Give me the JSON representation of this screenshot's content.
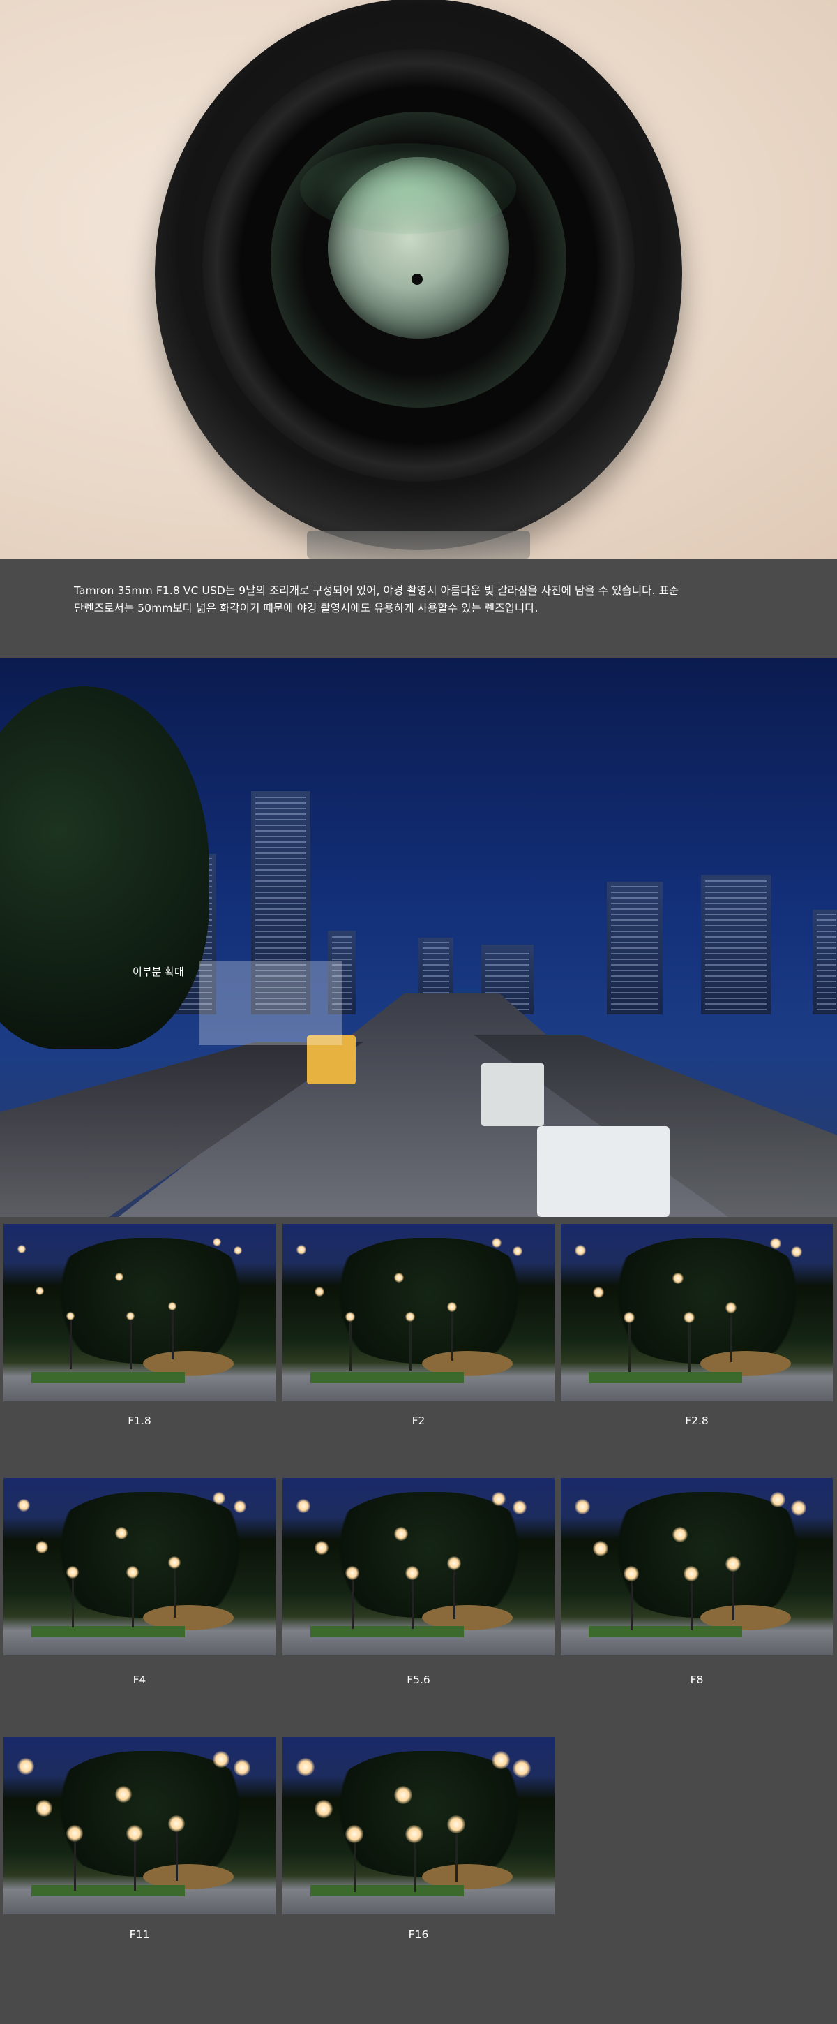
{
  "caption": {
    "line1": "Tamron 35mm F1.8 VC USD는 9날의 조리개로 구성되어 있어, 야경 촬영시 아름다운 빛 갈라짐을 사진에 담을 수 있습니다. 표준",
    "line2": "단렌즈로서는 50mm보다 넓은 화각이기 때문에 야경 촬영시에도 유용하게 사용할수 있는 렌즈입니다."
  },
  "city": {
    "zoom_label": "이부분 확대"
  },
  "apertures": [
    {
      "label": "F1.8"
    },
    {
      "label": "F2"
    },
    {
      "label": "F2.8"
    },
    {
      "label": "F4"
    },
    {
      "label": "F5.6"
    },
    {
      "label": "F8"
    },
    {
      "label": "F11"
    },
    {
      "label": "F16"
    }
  ]
}
